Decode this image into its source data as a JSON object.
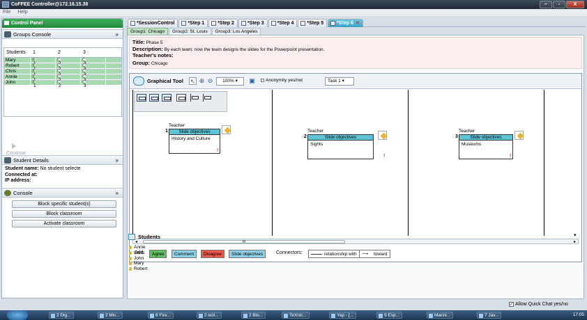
{
  "window": {
    "title": "CoFFEE Controller@172.16.15.38",
    "min": "–",
    "max": "▫",
    "close": "X"
  },
  "menu": [
    "File",
    "Help"
  ],
  "left": {
    "control_panel": "Control Panel",
    "groups_console": "Groups Console",
    "table_headers": [
      "Students",
      "1",
      "2",
      "3"
    ],
    "students": [
      {
        "name": "Mary",
        "selected": 1
      },
      {
        "name": "Robert",
        "selected": 1
      },
      {
        "name": "Chris",
        "selected": 1
      },
      {
        "name": "Annie",
        "selected": 1
      },
      {
        "name": "John",
        "selected": 1
      }
    ],
    "continue": "Continue",
    "student_details": "Student Details",
    "student_name_label": "Student name:",
    "student_name_value": "No student selecte",
    "connected_label": "Connected at:",
    "ip_label": "IP address:",
    "console": "Console",
    "btn_block_specific": "Block specific student(s)",
    "btn_block_classroom": "Block classroom",
    "btn_activate": "Activate classroom",
    "chevron": "»"
  },
  "tabs": [
    {
      "label": "*SessionControl"
    },
    {
      "label": "*Step 1"
    },
    {
      "label": "*Step 2"
    },
    {
      "label": "*Step 3"
    },
    {
      "label": "*Step 4"
    },
    {
      "label": "*Step 5"
    },
    {
      "label": "*Step 6"
    }
  ],
  "group_tabs": [
    "Group1: Chicago",
    "Group2: St. Louis",
    "Group3: Los Angeles"
  ],
  "info": {
    "title_label": "Title:",
    "title_value": "Phase 5",
    "desc_label": "Description:",
    "desc_value": "By each team: now the team designs the slides for the Powerpoint presentation.",
    "teacher_notes": "Teacher's notes:",
    "group_label": "Group:",
    "group_value": "Chicago"
  },
  "graph": {
    "title": "Graphical Tool",
    "zoom": "100%",
    "anonymity": "Anonymity yes/not",
    "task": "Task 1",
    "slides": [
      {
        "num": "1",
        "owner": "Teacher",
        "header": "Slide objectives",
        "text": "History and Culture"
      },
      {
        "num": "2",
        "owner": "Teacher",
        "header": "Slide objectives",
        "text": "Sights"
      },
      {
        "num": "3",
        "owner": "Teacher",
        "header": "Slide objectives",
        "text": "Museums"
      }
    ],
    "scroll_thumb": "III",
    "add_label": "Add:",
    "add_buttons": [
      {
        "label": "Agree",
        "color": "#5cbf5c"
      },
      {
        "label": "Comment",
        "color": "#8fd0e8"
      },
      {
        "label": "Disagree",
        "color": "#e8584a"
      },
      {
        "label": "Slide objectives",
        "color": "#8fd0e8"
      }
    ],
    "connectors_label": "Connectors:",
    "connector_relationship": "relationship with",
    "connector_toward": "toward"
  },
  "students_panel": {
    "title": "Students",
    "list": [
      "Annie",
      "Chris",
      "John",
      "Mary",
      "Robert"
    ]
  },
  "allow_chat": "Allow Quick Chat yes/no",
  "taskbar": {
    "items": [
      "2 Dig...",
      "2 Mic...",
      "8 Fire...",
      "2 ecli...",
      "2 Blo...",
      "TeXnic...",
      "Yap - [...",
      "9 Esp...",
      "Manni...",
      "7 Jav..."
    ],
    "clock": "17:05"
  }
}
